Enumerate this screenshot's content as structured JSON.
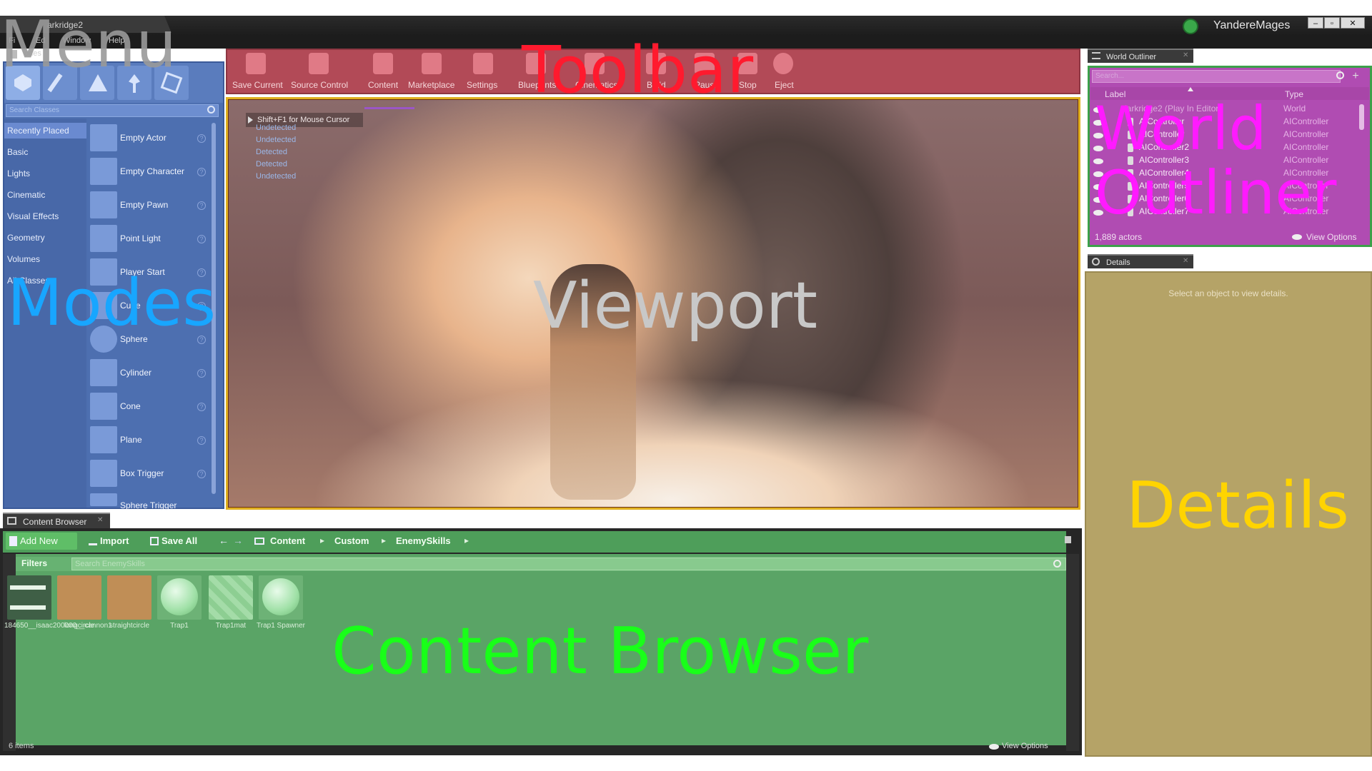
{
  "window": {
    "title": "arkridge2",
    "user": "YandereMages",
    "controls": [
      "–",
      "▫",
      "✕"
    ]
  },
  "menu": {
    "items": [
      "Fi",
      "Ed",
      "Window",
      "Help"
    ],
    "modes_label": "odes"
  },
  "overlay_labels": {
    "menu": "Menu",
    "toolbar": "Toolbar",
    "modes": "Modes",
    "viewport": "Viewport",
    "world_outliner_1": "World",
    "world_outliner_2": "Outliner",
    "details": "Details",
    "content_browser": "Content Browser"
  },
  "modes": {
    "search_placeholder": "Search Classes",
    "categories": [
      "Recently Placed",
      "Basic",
      "Lights",
      "Cinematic",
      "Visual Effects",
      "Geometry",
      "Volumes",
      "All Classes"
    ],
    "selected_category": "Recently Placed",
    "items": [
      "Empty Actor",
      "Empty Character",
      "Empty Pawn",
      "Point Light",
      "Player Start",
      "Cube",
      "Sphere",
      "Cylinder",
      "Cone",
      "Plane",
      "Box Trigger",
      "Sphere Trigger"
    ],
    "help_glyph": "?"
  },
  "toolbar": {
    "buttons": [
      "Save Current",
      "Source Control",
      "Content",
      "Marketplace",
      "Settings",
      "Blueprints",
      "Cinematics",
      "Build",
      "Pause",
      "Stop",
      "Eject"
    ]
  },
  "viewport": {
    "hint": "Shift+F1 for Mouse Cursor",
    "status_lines": [
      "Undetected",
      "Undetected",
      "Detected",
      "Detected",
      "Undetected"
    ]
  },
  "world_outliner": {
    "tab": "World Outliner",
    "search_placeholder": "Search...",
    "col_label": "Label",
    "col_type": "Type",
    "rows": [
      {
        "label": "darkridge2 (Play In Editor)",
        "type": "World"
      },
      {
        "label": "AIController",
        "type": "AIController"
      },
      {
        "label": "AIController",
        "type": "AIController"
      },
      {
        "label": "AIController2",
        "type": "AIController"
      },
      {
        "label": "AIController3",
        "type": "AIController"
      },
      {
        "label": "AIController4",
        "type": "AIController"
      },
      {
        "label": "AIController5",
        "type": "AIController"
      },
      {
        "label": "AIController6",
        "type": "AIController"
      },
      {
        "label": "AIController7",
        "type": "AIController"
      }
    ],
    "count": "1,889 actors",
    "view_options": "View Options"
  },
  "details": {
    "tab": "Details",
    "empty_message": "Select an object to view details."
  },
  "content_browser": {
    "tab": "Content Browser",
    "add_new": "Add New",
    "import": "Import",
    "save_all": "Save All",
    "breadcrumbs": [
      "Content",
      "Custom",
      "EnemySkills"
    ],
    "filters": "Filters",
    "search_placeholder": "Search EnemySkills",
    "assets": [
      {
        "name": "184650__isaac200000__cannon1",
        "kind": "sound"
      },
      {
        "name": "longcircle",
        "kind": "material"
      },
      {
        "name": "straightcircle",
        "kind": "material"
      },
      {
        "name": "Trap1",
        "kind": "mesh"
      },
      {
        "name": "Trap1mat",
        "kind": "texture"
      },
      {
        "name": "Trap1 Spawner",
        "kind": "blueprint"
      }
    ],
    "count": "6 items",
    "view_options": "View Options"
  },
  "colors": {
    "menu_label": "#9a9a9a",
    "toolbar_label": "#ff1a2e",
    "modes_label": "#18a6ff",
    "viewport_label": "#c8c8c8",
    "outliner_label": "#ff1aff",
    "details_label": "#ffd400",
    "browser_label": "#19ff19"
  }
}
